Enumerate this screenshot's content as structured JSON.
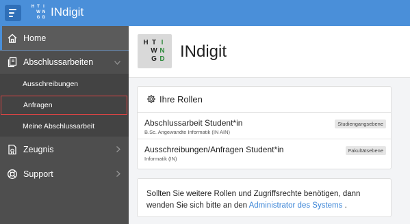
{
  "header": {
    "app_title": "INdigit",
    "logo_letters": [
      "H",
      "T",
      "I",
      "",
      "W",
      "N",
      "",
      "G",
      "D"
    ]
  },
  "sidebar": {
    "items": [
      {
        "label": "Home",
        "icon": "home-icon"
      },
      {
        "label": "Abschlussarbeiten",
        "icon": "documents-icon"
      },
      {
        "label": "Zeugnis",
        "icon": "certificate-icon"
      },
      {
        "label": "Support",
        "icon": "lifebuoy-icon"
      }
    ],
    "subitems": [
      {
        "label": "Ausschreibungen"
      },
      {
        "label": "Anfragen"
      },
      {
        "label": "Meine Abschlussarbeit"
      }
    ]
  },
  "hero": {
    "title": "INdigit",
    "logo_letters": [
      "H",
      "T",
      "I",
      "",
      "W",
      "N",
      "",
      "G",
      "D"
    ]
  },
  "roles": {
    "heading": "Ihre Rollen",
    "items": [
      {
        "title": "Abschlussarbeit Student*in",
        "subtitle": "B.Sc. Angewandte Informatik (IN AIN)",
        "badge": "Studiengangsebene"
      },
      {
        "title": "Ausschreibungen/Anfragen Student*in",
        "subtitle": "Informatik (IN)",
        "badge": "Fakultätsebene"
      }
    ]
  },
  "info": {
    "text_before": "Sollten Sie weitere Rollen und Zugriffsrechte benötigen, dann wenden Sie sich bitte an den ",
    "link_text": "Administrator des Systems",
    "text_after": " ."
  },
  "colors": {
    "accent": "#4a8fd9",
    "sidebar": "#4e4e4e",
    "link": "#3a84d6",
    "logo_green": "#2e8a3c",
    "highlight_border": "#e04444"
  }
}
